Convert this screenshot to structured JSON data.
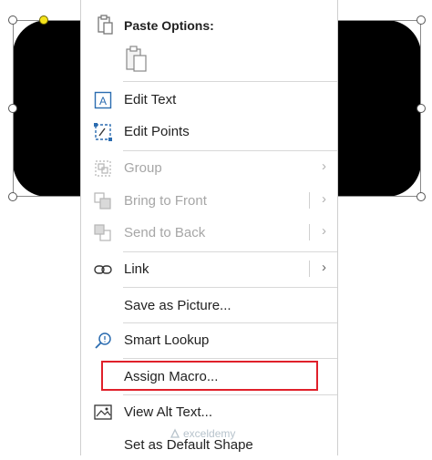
{
  "menu": {
    "paste_options_label": "Paste Options:",
    "items": [
      {
        "label": "Edit Text",
        "icon": "edit-text-icon",
        "enabled": true
      },
      {
        "label": "Edit Points",
        "icon": "edit-points-icon",
        "enabled": true
      },
      {
        "label": "Group",
        "icon": "group-icon",
        "enabled": false,
        "submenu": true
      },
      {
        "label": "Bring to Front",
        "icon": "bring-to-front-icon",
        "enabled": false,
        "submenu": true
      },
      {
        "label": "Send to Back",
        "icon": "send-to-back-icon",
        "enabled": false,
        "submenu": true
      },
      {
        "label": "Link",
        "icon": "link-icon",
        "enabled": true,
        "submenu": true
      },
      {
        "label": "Save as Picture...",
        "icon": "",
        "enabled": true
      },
      {
        "label": "Smart Lookup",
        "icon": "smart-lookup-icon",
        "enabled": true
      },
      {
        "label": "Assign Macro...",
        "icon": "",
        "enabled": true,
        "highlighted": true
      },
      {
        "label": "View Alt Text...",
        "icon": "alt-text-icon",
        "enabled": true
      },
      {
        "label": "Set as Default Shape",
        "icon": "",
        "enabled": true
      }
    ]
  },
  "watermark": "exceldemy",
  "colors": {
    "shape_fill": "#000000",
    "highlight_border": "#e0202a",
    "icon_blue": "#2b6cb0",
    "disabled_text": "#a6a6a6"
  }
}
